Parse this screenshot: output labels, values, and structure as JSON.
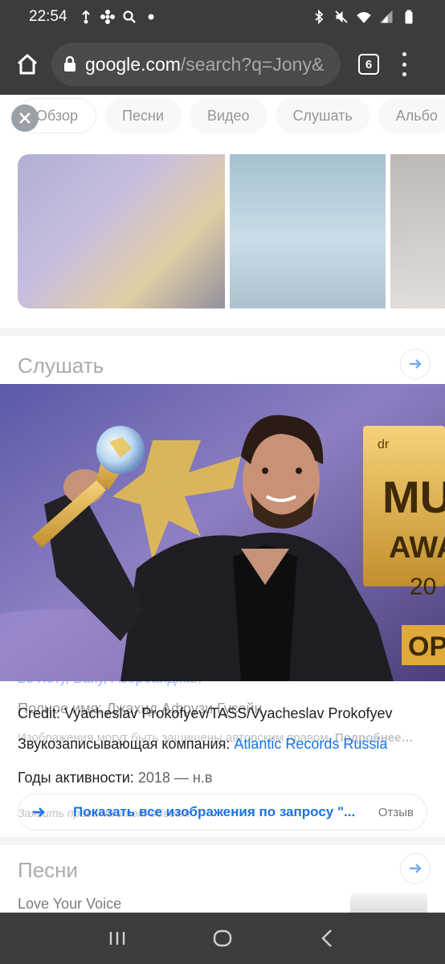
{
  "status_bar": {
    "time": "22:54",
    "icons_left": [
      "upload-icon",
      "pinwheel-icon",
      "search-icon",
      "dot-icon"
    ],
    "icons_right": [
      "bluetooth-icon",
      "mute-icon",
      "wifi-icon",
      "signal-icon",
      "battery-icon"
    ]
  },
  "browser": {
    "url_domain": "google.com",
    "url_path": "/search?q=Jony&",
    "tab_count": "6"
  },
  "chips": [
    "Обзор",
    "Песни",
    "Видео",
    "Слушать",
    "Альбо"
  ],
  "listen_section": {
    "title": "Слушать"
  },
  "info": {
    "born_fragment": "23 лет), Баку, Азербайджан",
    "full_name_fragment": "Полное имя: Джахид Афрузи Гусейн",
    "credit": "Credit: Vyacheslav Prokofyev/TASS/Vyacheslav Prokofyev",
    "copyright_note": "Изображения могут быть защищены авторским правом.",
    "more_link": "Подробнее…",
    "label_company": "Звукозаписывающая компания:",
    "company_value": "Atlantic Records Russia",
    "label_years": "Годы активности:",
    "years_value": "2018 — н.в",
    "report_text": "Заявить права на этот объект",
    "show_all": "Показать все изображения по запросу \"...",
    "feedback": "Отзыв"
  },
  "songs_section": {
    "title": "Песни",
    "first_song": "Love Your Voice"
  },
  "viewer_image": {
    "sign_text": "MU",
    "sign_text2": "AWA",
    "sign_small": "dr",
    "sign_num": "20",
    "sign_bottom": "OP"
  },
  "colors": {
    "system_bar": "#3c3c3e",
    "link_blue": "#1a73e8",
    "chip_bg": "#f1f3f4"
  }
}
